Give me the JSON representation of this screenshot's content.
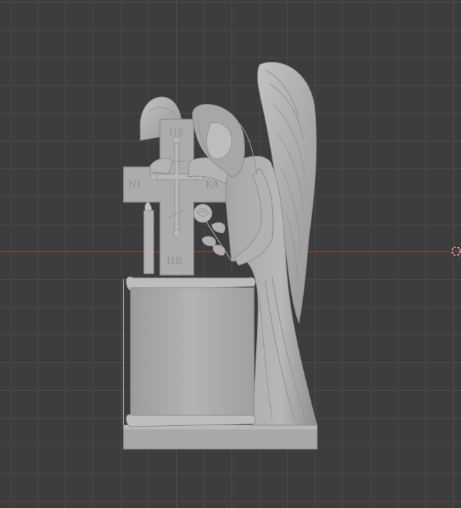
{
  "viewport": {
    "background_color": "#3d3d3d",
    "grid_color": "#4a4a4a",
    "x_axis_color": "#8b3a3a"
  },
  "model": {
    "surface_color": "#a9a9a9",
    "shadow_color": "#8a8a8a",
    "highlight_color": "#c4c4c4",
    "cross_inscriptions": {
      "top": "IIS",
      "left": "NI",
      "right": "KA",
      "bottom": "HR"
    }
  },
  "icons": [
    "origin-3d-cursor-icon"
  ]
}
